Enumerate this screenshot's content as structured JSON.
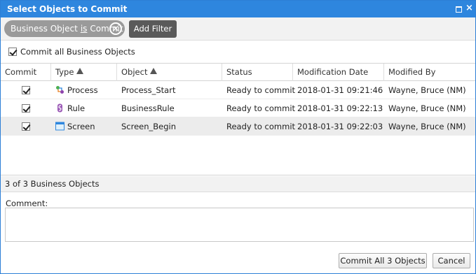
{
  "dialog": {
    "title": "Select Objects to Commit"
  },
  "filter": {
    "chip_field": "Business Object",
    "chip_operator": "is",
    "chip_value": "Commit",
    "add_filter_label": "Add Filter"
  },
  "commit_all": {
    "label": "Commit all Business Objects",
    "checked": true
  },
  "grid": {
    "columns": [
      "Commit",
      "Type",
      "Object",
      "Status",
      "Modification Date",
      "Modified By"
    ],
    "rows": [
      {
        "checked": true,
        "type": "Process",
        "type_icon": "process-icon",
        "object": "Process_Start",
        "status": "Ready to commit",
        "modified": "2018-01-31 09:21:46",
        "by": "Wayne, Bruce (NM)"
      },
      {
        "checked": true,
        "type": "Rule",
        "type_icon": "rule-icon",
        "object": "BusinessRule",
        "status": "Ready to commit",
        "modified": "2018-01-31 09:22:13",
        "by": "Wayne, Bruce (NM)"
      },
      {
        "checked": true,
        "type": "Screen",
        "type_icon": "screen-icon",
        "object": "Screen_Begin",
        "status": "Ready to commit",
        "modified": "2018-01-31 09:22:03",
        "by": "Wayne, Bruce (NM)"
      }
    ]
  },
  "footer": {
    "count_text": "3 of 3 Business Objects",
    "comment_label": "Comment:",
    "comment_value": "",
    "commit_button": "Commit All 3 Objects",
    "cancel_button": "Cancel"
  },
  "colors": {
    "titlebar": "#2e86de",
    "chip": "#9a9a9a",
    "add_filter": "#5a5a5a",
    "selected_row": "#ececec"
  }
}
